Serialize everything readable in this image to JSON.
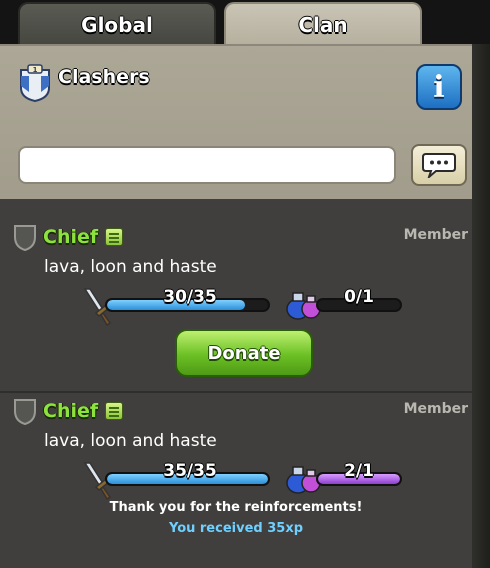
{
  "tabs": {
    "global": "Global",
    "clan": "Clan",
    "active": "Clan"
  },
  "clan": {
    "name": "Clashers",
    "info_icon": "i"
  },
  "chat": {
    "input_value": "",
    "send_icon": "speech-bubble-icon"
  },
  "messages": [
    {
      "sender": "Chief",
      "role": "Member",
      "text": "lava, loon and haste",
      "troops": {
        "label": "30/35",
        "progress": 0.857
      },
      "spells": {
        "label": "0/1",
        "progress": 0
      },
      "donate_label": "Donate"
    },
    {
      "sender": "Chief",
      "role": "Member",
      "text": "lava, loon and haste",
      "troops": {
        "label": "35/35",
        "progress": 1
      },
      "spells": {
        "label": "2/1",
        "progress": 1
      },
      "thanks": "Thank you for the reinforcements!",
      "xp": "You received 35xp"
    }
  ],
  "colors": {
    "sender": "#8de33d",
    "donate": "#6cc025",
    "troop_bar": "#2b8fd8",
    "spell_bar": "#8e3fd0",
    "xp": "#6fd0ff"
  }
}
